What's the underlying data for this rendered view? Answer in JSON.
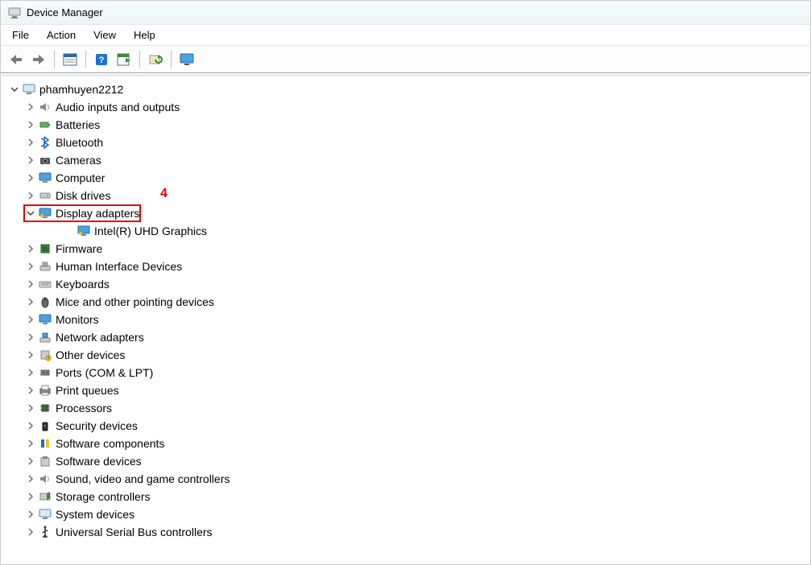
{
  "titlebar": {
    "title": "Device Manager"
  },
  "menu": {
    "file": "File",
    "action": "Action",
    "view": "View",
    "help": "Help"
  },
  "toolbar_icons": {
    "back": "back-arrow-icon",
    "forward": "forward-arrow-icon",
    "show_hidden": "show-hidden-icon",
    "help": "help-icon",
    "scan": "scan-hardware-icon",
    "update": "update-driver-icon",
    "monitor": "monitor-icon"
  },
  "root": {
    "name": "phamhuyen2212",
    "children": [
      {
        "label": "Audio inputs and outputs",
        "expanded": false,
        "icon": "speaker-icon"
      },
      {
        "label": "Batteries",
        "expanded": false,
        "icon": "battery-icon"
      },
      {
        "label": "Bluetooth",
        "expanded": false,
        "icon": "bluetooth-icon"
      },
      {
        "label": "Cameras",
        "expanded": false,
        "icon": "camera-icon"
      },
      {
        "label": "Computer",
        "expanded": false,
        "icon": "computer-icon"
      },
      {
        "label": "Disk drives",
        "expanded": false,
        "icon": "disk-icon"
      },
      {
        "label": "Display adapters",
        "expanded": true,
        "icon": "display-icon",
        "children": [
          {
            "label": "Intel(R) UHD Graphics",
            "icon": "display-icon"
          }
        ]
      },
      {
        "label": "Firmware",
        "expanded": false,
        "icon": "firmware-icon"
      },
      {
        "label": "Human Interface Devices",
        "expanded": false,
        "icon": "hid-icon"
      },
      {
        "label": "Keyboards",
        "expanded": false,
        "icon": "keyboard-icon"
      },
      {
        "label": "Mice and other pointing devices",
        "expanded": false,
        "icon": "mouse-icon"
      },
      {
        "label": "Monitors",
        "expanded": false,
        "icon": "monitor-icon"
      },
      {
        "label": "Network adapters",
        "expanded": false,
        "icon": "network-icon"
      },
      {
        "label": "Other devices",
        "expanded": false,
        "icon": "other-icon"
      },
      {
        "label": "Ports (COM & LPT)",
        "expanded": false,
        "icon": "port-icon"
      },
      {
        "label": "Print queues",
        "expanded": false,
        "icon": "printer-icon"
      },
      {
        "label": "Processors",
        "expanded": false,
        "icon": "cpu-icon"
      },
      {
        "label": "Security devices",
        "expanded": false,
        "icon": "security-icon"
      },
      {
        "label": "Software components",
        "expanded": false,
        "icon": "software-comp-icon"
      },
      {
        "label": "Software devices",
        "expanded": false,
        "icon": "software-dev-icon"
      },
      {
        "label": "Sound, video and game controllers",
        "expanded": false,
        "icon": "sound-icon"
      },
      {
        "label": "Storage controllers",
        "expanded": false,
        "icon": "storage-icon"
      },
      {
        "label": "System devices",
        "expanded": false,
        "icon": "system-icon"
      },
      {
        "label": "Universal Serial Bus controllers",
        "expanded": false,
        "icon": "usb-icon"
      }
    ]
  },
  "annotation": {
    "label": "4"
  }
}
